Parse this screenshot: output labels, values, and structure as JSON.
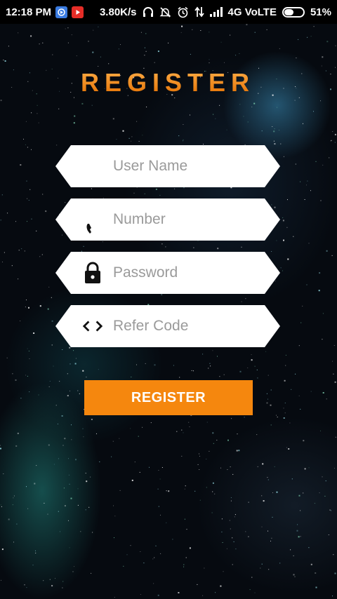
{
  "status_bar": {
    "time": "12:18 PM",
    "speed": "3.80K/s",
    "network": "4G VoLTE",
    "battery": "51%",
    "battery_level": 0.51
  },
  "header": {
    "title": "REGISTER",
    "title_color": "#f5870e"
  },
  "form": {
    "username_placeholder": "User Name",
    "number_placeholder": "Number",
    "password_placeholder": "Password",
    "refer_placeholder": "Refer Code",
    "submit_label": "REGISTER"
  },
  "icons": {
    "username": "none",
    "number": "phone-icon",
    "password": "lock-icon",
    "refer": "code-icon"
  },
  "colors": {
    "accent": "#f5870e",
    "field_bg": "#ffffff",
    "placeholder": "#9a9a9a"
  }
}
